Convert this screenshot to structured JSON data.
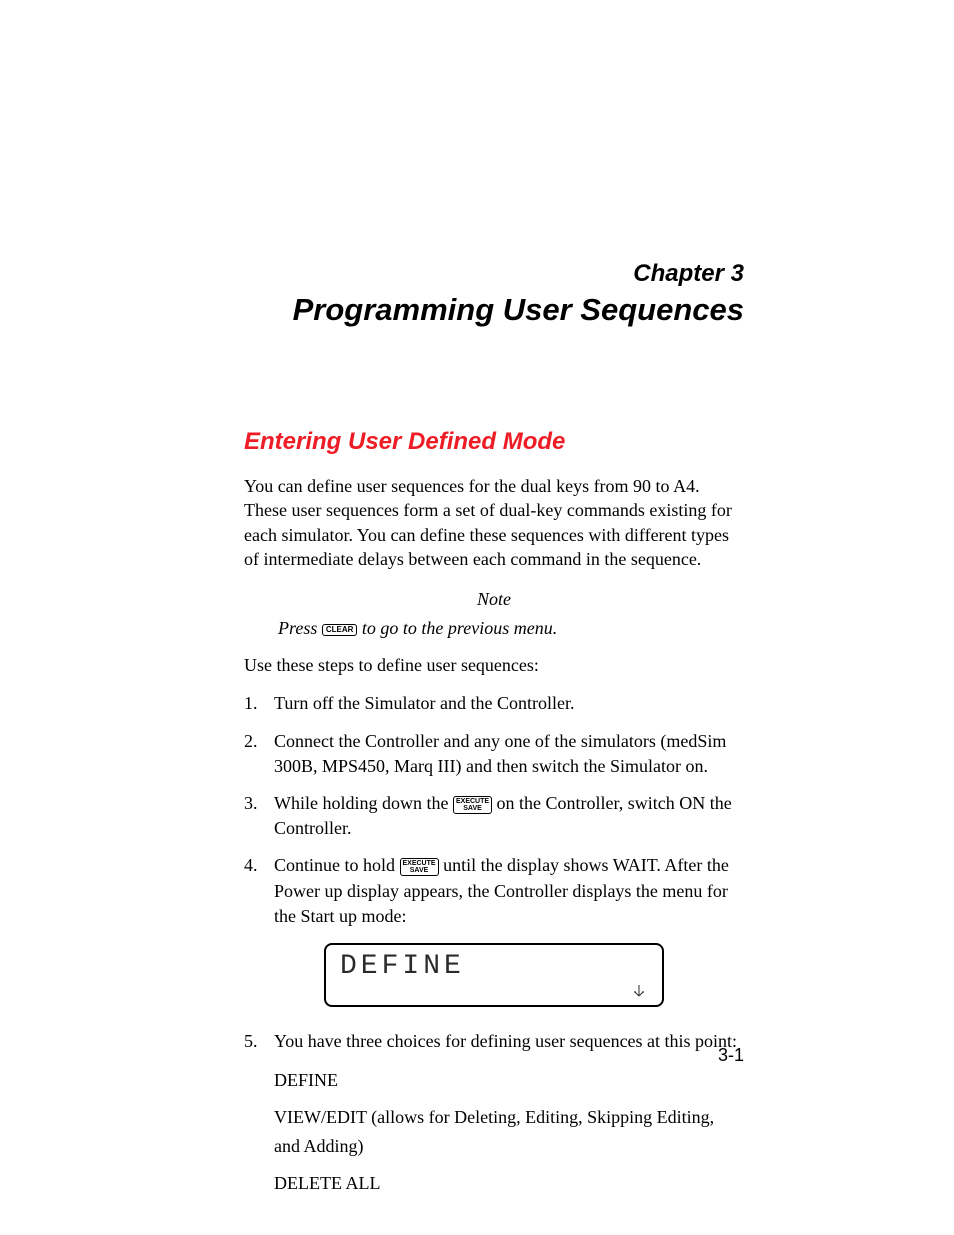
{
  "chapter": {
    "label": "Chapter 3",
    "title": "Programming User Sequences"
  },
  "section": {
    "heading": "Entering User Defined Mode",
    "intro": "You can define user sequences for the dual keys from 90 to A4. These user sequences form a set of dual-key commands existing for each simulator. You can define these sequences with different types of intermediate delays between each command in the sequence.",
    "note_label": "Note",
    "note_press": "Press ",
    "note_key": "CLEAR",
    "note_rest": " to go to the previous menu.",
    "lead_in": "Use these steps to define user sequences:"
  },
  "key_execute_save": {
    "line1": "EXECUTE",
    "line2": "SAVE"
  },
  "steps": [
    {
      "n": "1.",
      "text": "Turn off the Simulator and the Controller."
    },
    {
      "n": "2.",
      "text": "Connect the Controller and any one of the simulators (medSim 300B, MPS450, Marq III) and then switch the Simulator on."
    },
    {
      "n": "3.",
      "pre": "While holding down the ",
      "post": " on the Controller, switch ON the Controller."
    },
    {
      "n": "4.",
      "pre": "Continue to hold ",
      "post": " until the display shows WAIT. After the Power up display appears, the Controller displays the menu for the Start up mode:"
    },
    {
      "n": "5.",
      "text": "You have three choices for defining user sequences at this point:"
    }
  ],
  "lcd": {
    "text": "DEFINE"
  },
  "choices": [
    "DEFINE",
    "VIEW/EDIT (allows for Deleting, Editing, Skipping Editing, and Adding)",
    "DELETE ALL"
  ],
  "page_number": "3-1"
}
